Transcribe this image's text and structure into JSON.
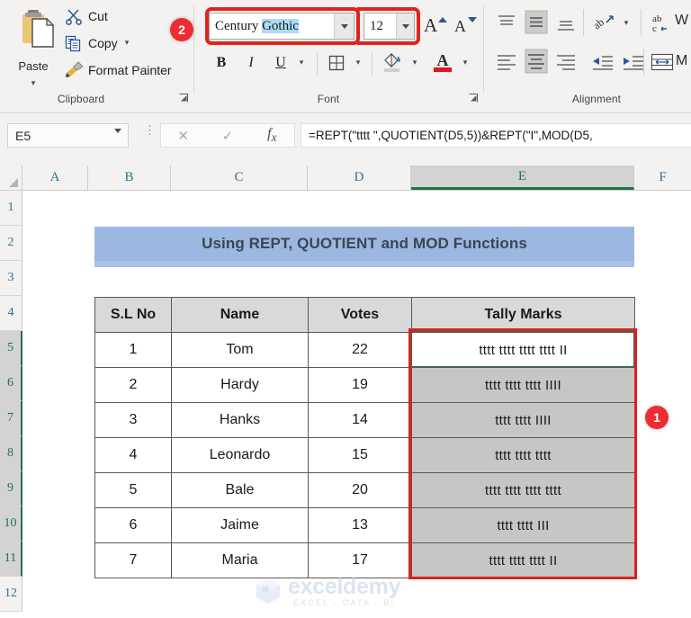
{
  "ribbon": {
    "clipboard": {
      "group_label": "Clipboard",
      "paste_label": "Paste",
      "cut_label": "Cut",
      "copy_label": "Copy",
      "format_painter_label": "Format Painter",
      "dialog_launcher": "dialog-launcher-icon"
    },
    "font": {
      "group_label": "Font",
      "font_name_value_unselected": "Century ",
      "font_name_value_selected": "Gothic",
      "font_size_value": "12",
      "grow_font_label": "A",
      "shrink_font_label": "A",
      "bold_label": "B",
      "italic_label": "I",
      "underline_label": "U",
      "borders_icon": "borders-icon",
      "fill_color_icon": "fill-color-icon",
      "font_color_icon": "font-color-icon",
      "font_color_swatch": "#e81123"
    },
    "alignment": {
      "group_label": "Alignment",
      "top_align_icon": "align-top-icon",
      "middle_align_icon": "align-middle-icon",
      "bottom_align_icon": "align-bottom-icon",
      "orientation_icon": "text-orientation-icon",
      "align_left_icon": "align-left-icon",
      "align_center_icon": "align-center-icon",
      "align_right_icon": "align-right-icon",
      "decrease_indent_icon": "decrease-indent-icon",
      "increase_indent_icon": "increase-indent-icon",
      "wrap_text_label": "W",
      "merge_center_label": "M"
    }
  },
  "formula_bar": {
    "name_box_value": "E5",
    "cancel_icon": "cancel-icon",
    "enter_icon": "confirm-check-icon",
    "insert_function_icon": "fx-icon",
    "formula_value": "=REPT(\"tttt \",QUOTIENT(D5,5))&REPT(\"I\",MOD(D5,"
  },
  "grid": {
    "columns": [
      "A",
      "B",
      "C",
      "D",
      "E",
      "F"
    ],
    "active_column": "E",
    "rows": [
      "1",
      "2",
      "3",
      "4",
      "5",
      "6",
      "7",
      "8",
      "9",
      "10",
      "11",
      "12"
    ],
    "selected_rows": [
      "5",
      "6",
      "7",
      "8",
      "9",
      "10",
      "11"
    ],
    "title_banner": "Using REPT, QUOTIENT and MOD Functions",
    "table": {
      "headers": [
        "S.L No",
        "Name",
        "Votes",
        "Tally Marks"
      ],
      "rows": [
        {
          "sl": "1",
          "name": "Tom",
          "votes": "22",
          "tally": "tttt tttt tttt tttt II"
        },
        {
          "sl": "2",
          "name": "Hardy",
          "votes": "19",
          "tally": "tttt tttt tttt IIII"
        },
        {
          "sl": "3",
          "name": "Hanks",
          "votes": "14",
          "tally": "tttt tttt IIII"
        },
        {
          "sl": "4",
          "name": "Leonardo",
          "votes": "15",
          "tally": "tttt tttt tttt"
        },
        {
          "sl": "5",
          "name": "Bale",
          "votes": "20",
          "tally": "tttt tttt tttt tttt"
        },
        {
          "sl": "6",
          "name": "Jaime",
          "votes": "13",
          "tally": "tttt tttt III"
        },
        {
          "sl": "7",
          "name": "Maria",
          "votes": "17",
          "tally": "tttt tttt tttt II"
        }
      ]
    }
  },
  "annotations": {
    "badge_one": "1",
    "badge_two": "2",
    "highlight_color": "#e2231a"
  },
  "watermark": {
    "brand": "exceldemy",
    "tagline": "EXCEL  -  DATA  -  BI"
  }
}
